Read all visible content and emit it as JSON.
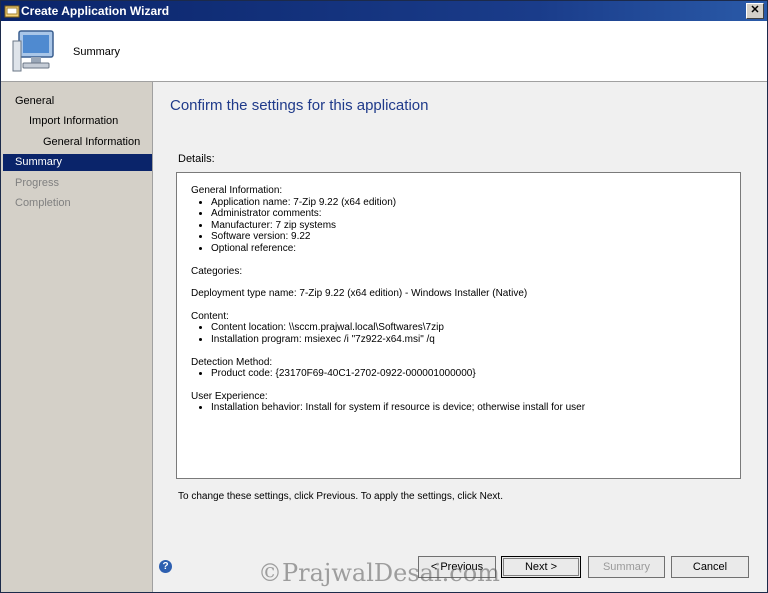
{
  "window": {
    "title": "Create Application Wizard",
    "page_name": "Summary",
    "close_glyph": "✕"
  },
  "sidebar": {
    "items": [
      {
        "label": "General",
        "state": "normal"
      },
      {
        "label": "Import Information",
        "state": "normal"
      },
      {
        "label": "General Information",
        "state": "normal"
      },
      {
        "label": "Summary",
        "state": "active"
      },
      {
        "label": "Progress",
        "state": "disabled"
      },
      {
        "label": "Completion",
        "state": "disabled"
      }
    ]
  },
  "main": {
    "heading": "Confirm the settings for this application",
    "details_label": "Details:",
    "details": {
      "general_info_title": "General Information:",
      "general_info_items": [
        "Application name: 7-Zip 9.22 (x64 edition)",
        "Administrator comments:",
        "Manufacturer: 7 zip systems",
        "Software version: 9.22",
        "Optional reference:"
      ],
      "categories": "Categories:",
      "deployment_type": "Deployment type name: 7-Zip 9.22 (x64 edition) - Windows Installer (Native)",
      "content_title": "Content:",
      "content_items": [
        "Content location: \\\\sccm.prajwal.local\\Softwares\\7zip",
        "Installation program: msiexec /i \"7z922-x64.msi\" /q"
      ],
      "detection_title": "Detection Method:",
      "detection_items": [
        "Product code: {23170F69-40C1-2702-0922-000001000000}"
      ],
      "ux_title": "User Experience:",
      "ux_items": [
        "Installation behavior: Install for system if resource is device; otherwise install for user"
      ]
    },
    "footer_text": "To change these settings, click Previous. To apply the settings, click Next."
  },
  "buttons": {
    "help_glyph": "?",
    "previous": "< Previous",
    "next": "Next >",
    "summary": "Summary",
    "cancel": "Cancel"
  },
  "watermark": "©PrajwalDesai.com"
}
